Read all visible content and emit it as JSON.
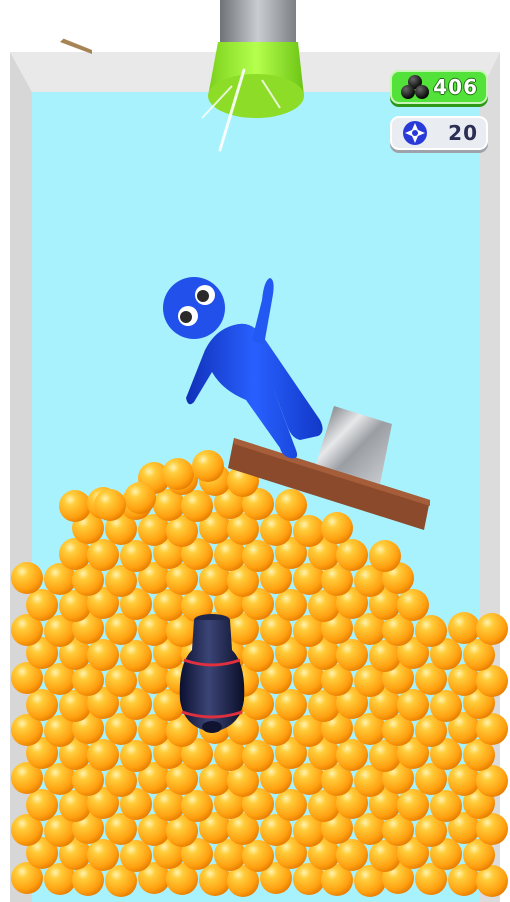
{
  "hud": {
    "balls_count": "406",
    "balls_icon": "balls-icon",
    "bombs_count": "20",
    "bombs_icon": "bomb-icon"
  },
  "controls": {
    "back_icon": "triangle-back-icon"
  },
  "colors": {
    "sky": "#a8f2fd",
    "ball": "#ffae1a",
    "pipe_cup": "#9cf02e",
    "character": "#1a4fe0",
    "plank": "#8b4a2b",
    "hud_green": "#53e23a"
  }
}
